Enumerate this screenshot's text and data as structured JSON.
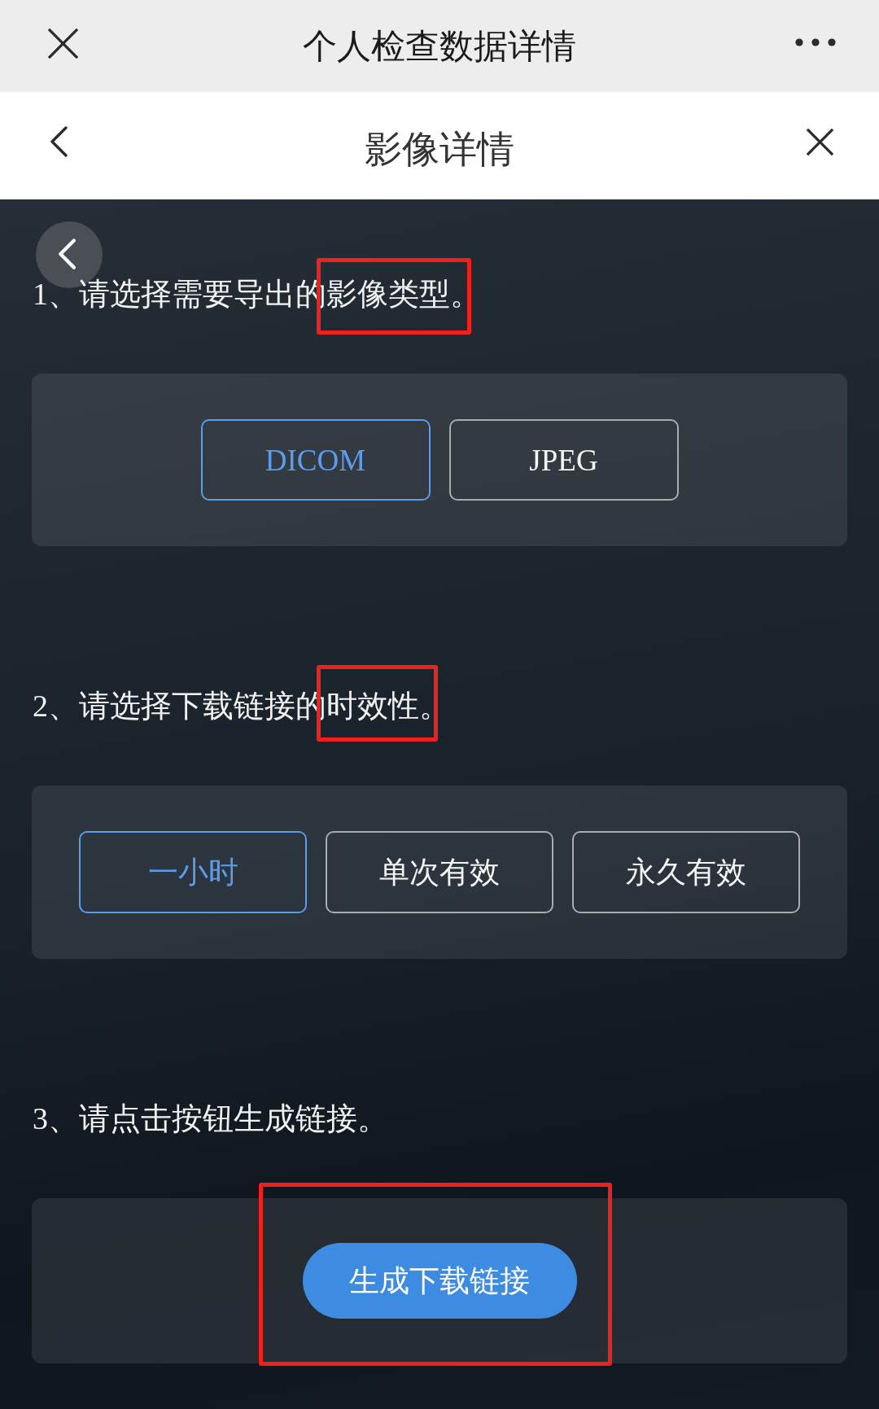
{
  "top_bar": {
    "title": "个人检查数据详情"
  },
  "nav_bar": {
    "title": "影像详情"
  },
  "sections": [
    {
      "kind": "choice",
      "title": "1、请选择需要导出的影像类型。",
      "highlighted": true,
      "options": [
        {
          "label": "DICOM",
          "selected": true
        },
        {
          "label": "JPEG",
          "selected": false
        }
      ]
    },
    {
      "kind": "choice",
      "title": "2、请选择下载链接的时效性。",
      "highlighted": true,
      "options": [
        {
          "label": "一小时",
          "selected": true
        },
        {
          "label": "单次有效",
          "selected": false
        },
        {
          "label": "永久有效",
          "selected": false
        }
      ]
    },
    {
      "kind": "action",
      "title": "3、请点击按钮生成链接。",
      "highlighted": true,
      "button": "生成下载链接"
    }
  ]
}
